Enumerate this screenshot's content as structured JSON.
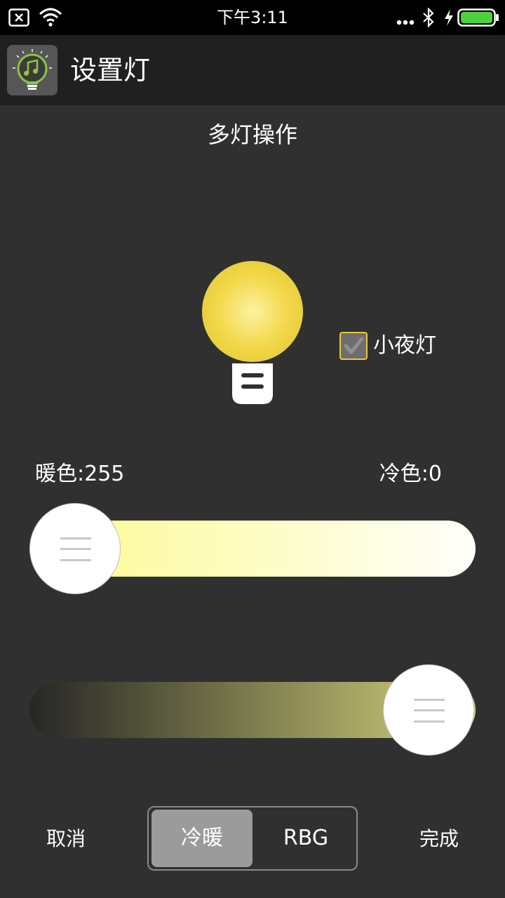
{
  "status_bar": {
    "time": "下午3:11",
    "icons": [
      "notification-x-icon",
      "wifi-icon",
      "more-dots-icon",
      "bluetooth-icon",
      "charging-icon",
      "battery-icon"
    ]
  },
  "app_bar": {
    "title": "设置灯",
    "icon": "bulb-music-app-icon"
  },
  "main": {
    "section_title": "多灯操作",
    "bulb_color": "#f2d84a",
    "night_light": {
      "label": "小夜灯",
      "checked": true
    },
    "warm_label": "暖色:255",
    "cool_label": "冷色:0",
    "warm_slider": {
      "value_fraction": 0.0
    },
    "brightness_slider": {
      "value_fraction": 1.0
    }
  },
  "bottom_bar": {
    "cancel_label": "取消",
    "done_label": "完成",
    "tabs": [
      {
        "label": "冷暖",
        "active": true
      },
      {
        "label": "RBG",
        "active": false
      }
    ]
  },
  "colors": {
    "background": "#303030",
    "app_bar": "#202020",
    "accent_yellow": "#f2d84a",
    "checkbox_border": "#e8c93a"
  }
}
